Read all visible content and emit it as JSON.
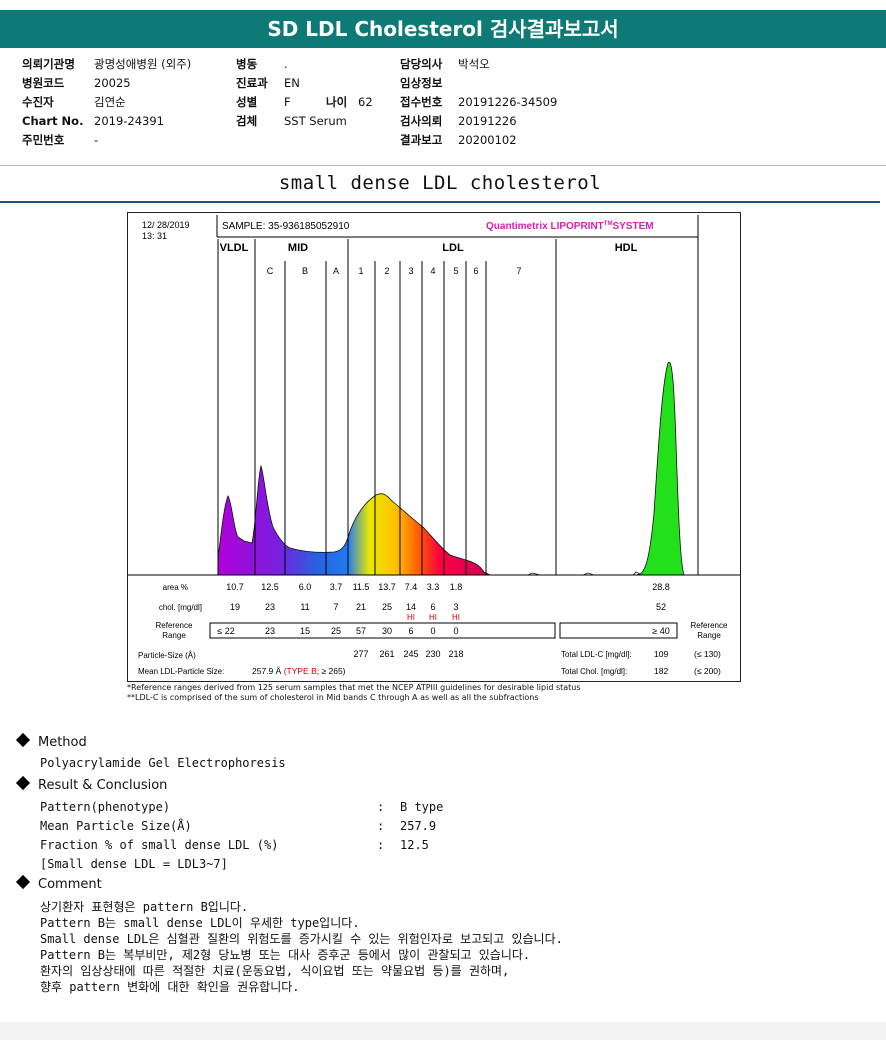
{
  "header": {
    "title": "SD LDL Cholesterol 검사결과보고서"
  },
  "info": {
    "col1": [
      {
        "k": "의뢰기관명",
        "v": "광명성애병원 (외주)"
      },
      {
        "k": "병원코드",
        "v": "20025"
      },
      {
        "k": "수진자",
        "v": "김연순"
      },
      {
        "k": "Chart No.",
        "v": "2019-24391"
      },
      {
        "k": "주민번호",
        "v": "-"
      }
    ],
    "col2": [
      {
        "k": "병동",
        "v": "."
      },
      {
        "k": "진료과",
        "v": "EN"
      },
      {
        "k": "성별",
        "v": "F"
      },
      {
        "k": "검체",
        "v": "SST Serum"
      }
    ],
    "age": {
      "k": "나이",
      "v": "62"
    },
    "col3": [
      {
        "k": "담당의사",
        "v": "박석오"
      },
      {
        "k": "임상정보",
        "v": ""
      },
      {
        "k": "접수번호",
        "v": "20191226-34509"
      },
      {
        "k": "검사의뢰",
        "v": "20191226"
      },
      {
        "k": "결과보고",
        "v": "20200102"
      }
    ]
  },
  "subtitle": "small dense LDL cholesterol",
  "chart": {
    "date": "12/ 28/2019",
    "time": "13: 31",
    "sample": "SAMPLE:  35-936185052910",
    "brand": "Quantimetrix LIPOPRINT",
    "brand_tm": "TM",
    "brand_sys": "SYSTEM",
    "groups": [
      "VLDL",
      "MID",
      "LDL",
      "HDL"
    ],
    "bands": [
      "C",
      "B",
      "A",
      "1",
      "2",
      "3",
      "4",
      "5",
      "6",
      "7"
    ],
    "row_labels": {
      "area": "area %",
      "chol": "chol. [mg/dl]",
      "ref1": "Reference",
      "ref2": "Range",
      "particle": "Particle-Size (Å)",
      "mean": "Mean LDL-Particle Size:"
    },
    "area": [
      "10.7",
      "12.5",
      "6.0",
      "3.7",
      "11.5",
      "13.7",
      "7.4",
      "3.3",
      "1.8",
      "",
      "28.8"
    ],
    "chol": [
      "19",
      "23",
      "11",
      "7",
      "21",
      "25",
      "14",
      "6",
      "3",
      "",
      "52"
    ],
    "hi": [
      "",
      "",
      "",
      "",
      "",
      "",
      "HI",
      "HI",
      "HI",
      "",
      ""
    ],
    "ref": [
      "≤ 22",
      "23",
      "15",
      "25",
      "57",
      "30",
      "6",
      "0",
      "0",
      "",
      "≥ 40"
    ],
    "particle": [
      "",
      "",
      "",
      "",
      "277",
      "261",
      "245",
      "230",
      "218",
      "",
      ""
    ],
    "mean_value": "257.9 Å",
    "mean_type": "(TYPE B",
    "mean_ref": "; ≥ 265)",
    "right_ref1": "Reference",
    "right_ref2": "Range",
    "total_ldl_label": "Total LDL-C [mg/dl]:",
    "total_ldl": "109",
    "total_ldl_ref": "(≤ 130)",
    "total_chol_label": "Total Chol. [mg/dl]:",
    "total_chol": "182",
    "total_chol_ref": "(≤ 200)"
  },
  "chart_data": {
    "type": "area",
    "title": "",
    "categories": [
      "VLDL",
      "C",
      "B",
      "A",
      "1",
      "2",
      "3",
      "4",
      "5",
      "6",
      "7",
      "HDL"
    ],
    "series": [
      {
        "name": "area %",
        "values": [
          10.7,
          12.5,
          6.0,
          3.7,
          11.5,
          13.7,
          7.4,
          3.3,
          1.8,
          null,
          null,
          28.8
        ]
      },
      {
        "name": "chol. [mg/dl]",
        "values": [
          19,
          23,
          11,
          7,
          21,
          25,
          14,
          6,
          3,
          null,
          null,
          52
        ]
      }
    ]
  },
  "notes": [
    "*Reference ranges derived from 125 serum samples that met the NCEP ATPIII guidelines for desirable lipid status",
    "**LDL-C is comprised of the sum of cholesterol in Mid bands C through A as well as all the subfractions"
  ],
  "method": {
    "title": "Method",
    "text": "Polyacrylamide Gel Electrophoresis"
  },
  "result": {
    "title": "Result & Conclusion",
    "rows": [
      {
        "k": "Pattern(phenotype)",
        "v": "B type"
      },
      {
        "k": "Mean Particle Size(Å)",
        "v": "257.9"
      },
      {
        "k": "Fraction % of small dense LDL (%)",
        "v": "12.5"
      }
    ],
    "sep": ":",
    "footnote": "[Small dense LDL = LDL3~7]"
  },
  "comment": {
    "title": "Comment",
    "lines": [
      "상기환자 표현형은 pattern B입니다.",
      "Pattern B는 small dense LDL이 우세한 type입니다.",
      "Small dense LDL은 심혈관 질환의 위험도를 증가시킬 수 있는 위험인자로 보고되고 있습니다.",
      "Pattern B는 복부비만, 제2형 당뇨병 또는 대사 증후군 등에서 많이 관찰되고 있습니다.",
      "환자의 임상상태에 따른 적절한 치료(운동요법, 식이요법 또는 약물요법 등)를 권하며,",
      "향후 pattern 변화에 대한 확인을 권유합니다."
    ]
  },
  "colors": {
    "header": "#0d7a76",
    "brand": "#d61fb5",
    "hi": "#d00000"
  }
}
